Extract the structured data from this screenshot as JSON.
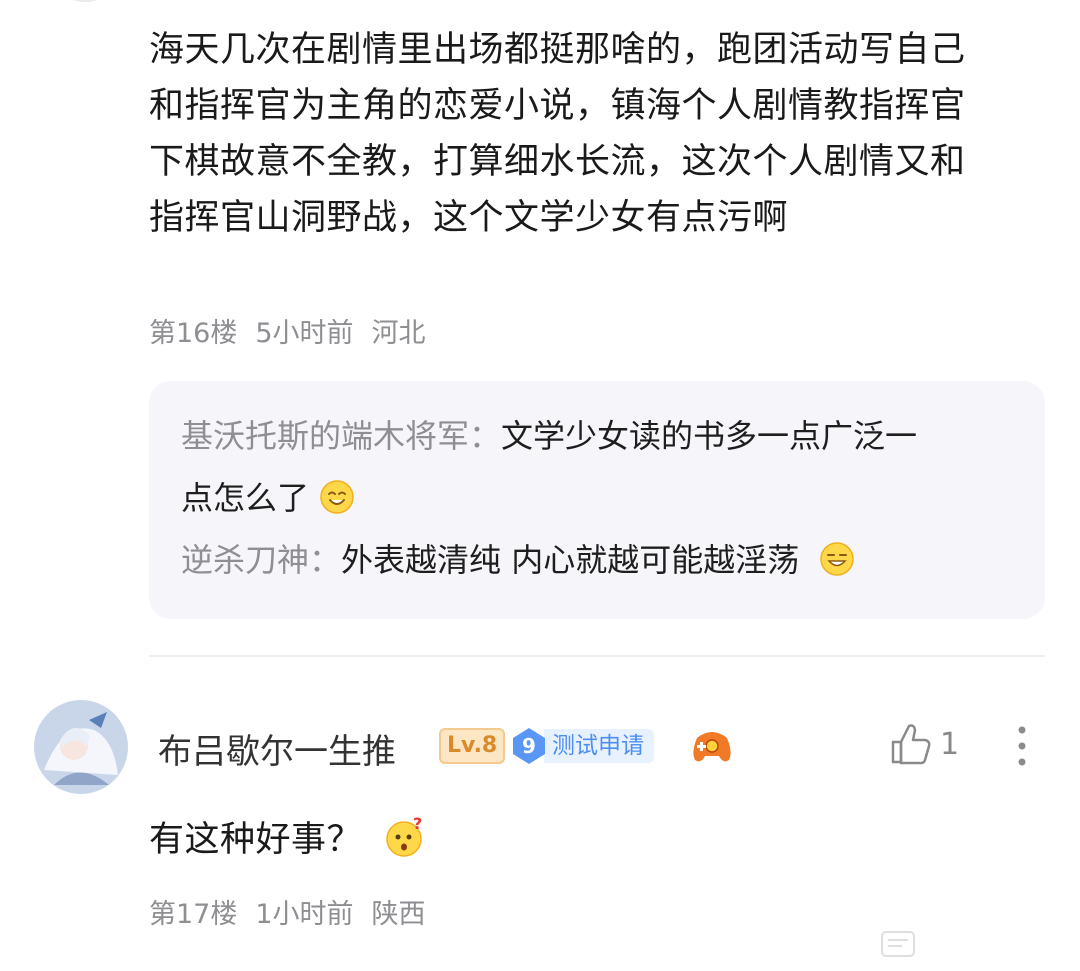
{
  "post16": {
    "lines": [
      "海天几次在剧情里出场都挺那啥的，跑团活动写自己",
      "和指挥官为主角的恋爱小说，镇海个人剧情教指挥官",
      "下棋故意不全教，打算细水长流，这次个人剧情又和",
      "指挥官山洞野战，这个文学少女有点污啊"
    ],
    "floor": "第16楼",
    "time": "5小时前",
    "location": "河北"
  },
  "replies": [
    {
      "author": "基沃托斯的端木将军：",
      "line1": "文学少女读的书多一点广泛一",
      "line2": "点怎么了",
      "emoji": "smile-emoji"
    },
    {
      "author": "逆杀刀神：",
      "line1": "外表越清纯 内心就越可能越淫荡",
      "emoji": "grin-emoji"
    }
  ],
  "post17": {
    "username": "布吕歇尔一生推",
    "level": "Lv.8",
    "tag_number": "9",
    "tag_text": "测试申请",
    "like_count": "1",
    "text": "有这种好事？",
    "emoji": "thinking-emoji",
    "floor": "第17楼",
    "time": "1小时前",
    "location": "陕西"
  },
  "colors": {
    "meta_gray": "#8e8e93",
    "reply_bg": "#f5f5fa",
    "level_orange": "#d98a2b",
    "tag_blue": "#4e8ff3"
  },
  "icons": [
    "thumbs-up-icon",
    "more-vertical-icon",
    "game-controller-icon",
    "avatar-image"
  ]
}
